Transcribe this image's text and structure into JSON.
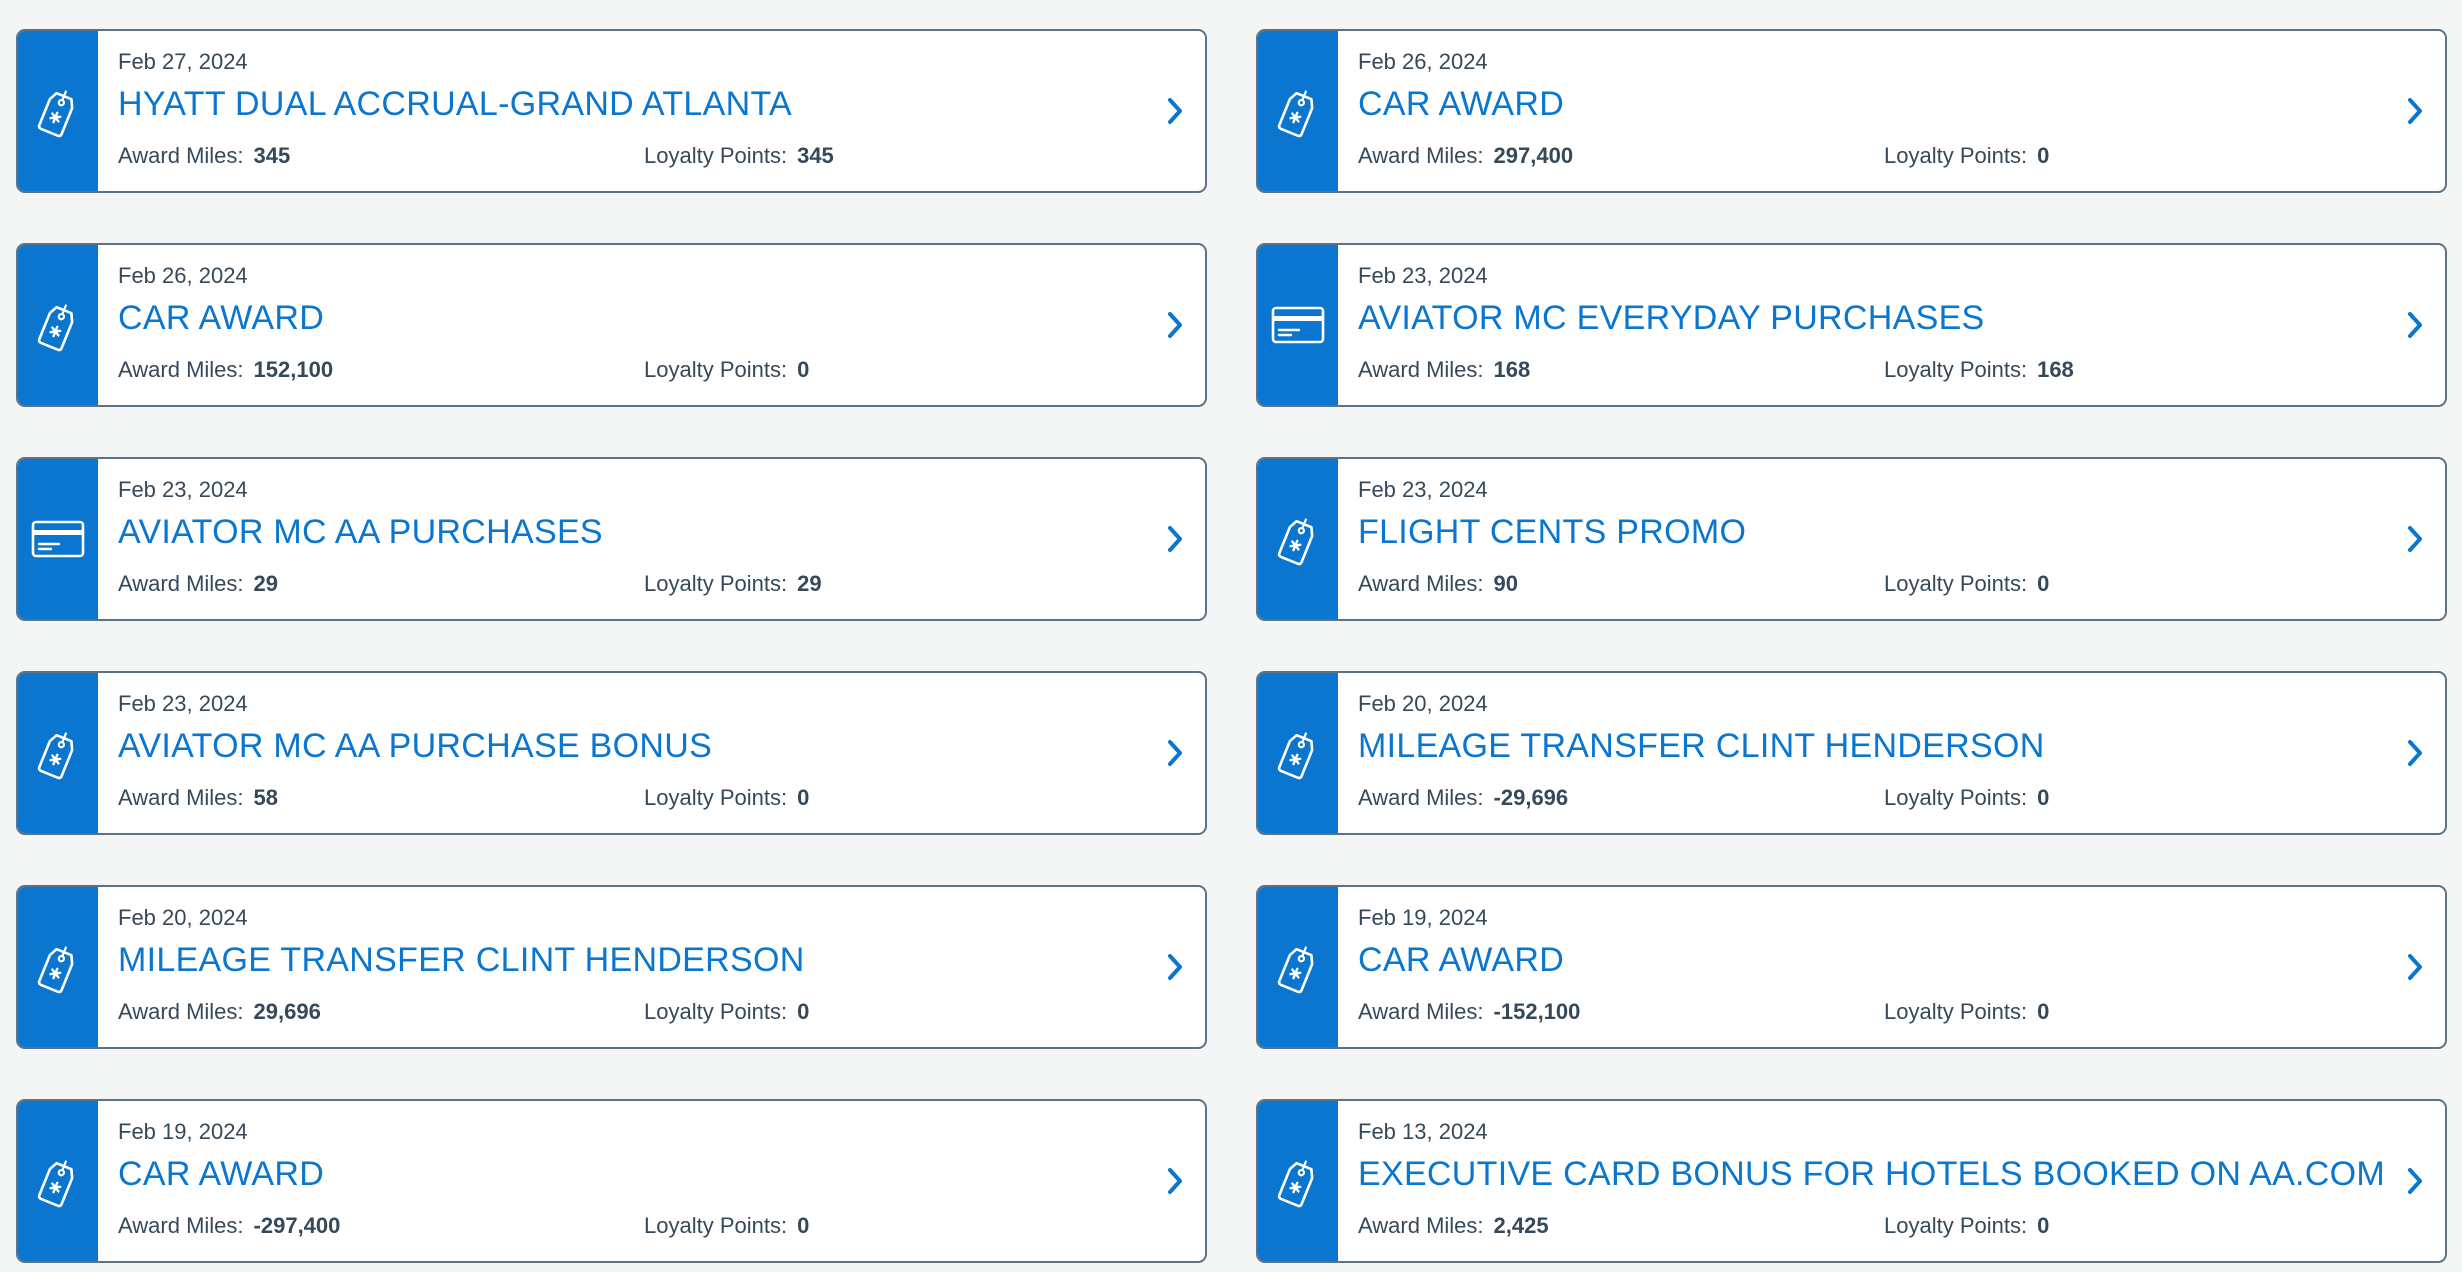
{
  "stat_labels": {
    "award_miles": "Award Miles:",
    "loyalty_points": "Loyalty Points:"
  },
  "colors": {
    "accent": "#0a76cf",
    "text": "#36495a",
    "border": "#5d7285",
    "background": "#f4f6f6"
  },
  "icons": {
    "tag": "tag-icon",
    "card": "credit-card-icon",
    "chevron": "chevron-right-icon"
  },
  "transactions": [
    {
      "date": "Feb 27, 2024",
      "title": "HYATT DUAL ACCRUAL-GRAND ATLANTA",
      "award_miles": "345",
      "loyalty_points": "345",
      "icon": "tag-icon"
    },
    {
      "date": "Feb 26, 2024",
      "title": "CAR AWARD",
      "award_miles": "297,400",
      "loyalty_points": "0",
      "icon": "tag-icon"
    },
    {
      "date": "Feb 26, 2024",
      "title": "CAR AWARD",
      "award_miles": "152,100",
      "loyalty_points": "0",
      "icon": "tag-icon"
    },
    {
      "date": "Feb 23, 2024",
      "title": "AVIATOR MC EVERYDAY PURCHASES",
      "award_miles": "168",
      "loyalty_points": "168",
      "icon": "credit-card-icon"
    },
    {
      "date": "Feb 23, 2024",
      "title": "AVIATOR MC AA PURCHASES",
      "award_miles": "29",
      "loyalty_points": "29",
      "icon": "credit-card-icon"
    },
    {
      "date": "Feb 23, 2024",
      "title": "FLIGHT CENTS PROMO",
      "award_miles": "90",
      "loyalty_points": "0",
      "icon": "tag-icon"
    },
    {
      "date": "Feb 23, 2024",
      "title": "AVIATOR MC AA PURCHASE BONUS",
      "award_miles": "58",
      "loyalty_points": "0",
      "icon": "tag-icon"
    },
    {
      "date": "Feb 20, 2024",
      "title": "MILEAGE TRANSFER CLINT HENDERSON",
      "award_miles": "-29,696",
      "loyalty_points": "0",
      "icon": "tag-icon"
    },
    {
      "date": "Feb 20, 2024",
      "title": "MILEAGE TRANSFER CLINT HENDERSON",
      "award_miles": "29,696",
      "loyalty_points": "0",
      "icon": "tag-icon"
    },
    {
      "date": "Feb 19, 2024",
      "title": "CAR AWARD",
      "award_miles": "-152,100",
      "loyalty_points": "0",
      "icon": "tag-icon"
    },
    {
      "date": "Feb 19, 2024",
      "title": "CAR AWARD",
      "award_miles": "-297,400",
      "loyalty_points": "0",
      "icon": "tag-icon"
    },
    {
      "date": "Feb 13, 2024",
      "title": "EXECUTIVE CARD BONUS FOR HOTELS BOOKED ON AA.COM",
      "award_miles": "2,425",
      "loyalty_points": "0",
      "icon": "tag-icon"
    }
  ]
}
